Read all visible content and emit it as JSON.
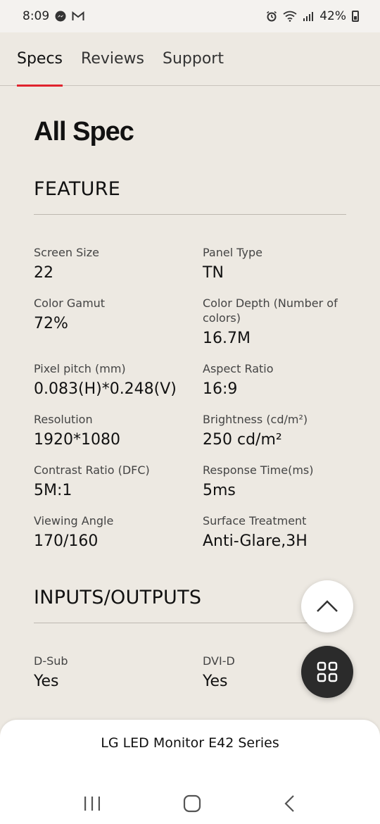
{
  "status_bar": {
    "time": "8:09",
    "battery_pct": "42%"
  },
  "tabs": [
    {
      "label": "Specs",
      "active": true
    },
    {
      "label": "Reviews",
      "active": false
    },
    {
      "label": "Support",
      "active": false
    }
  ],
  "page_title": "All Spec",
  "sections": [
    {
      "title": "FEATURE",
      "specs": [
        {
          "label": "Screen Size",
          "value": "22"
        },
        {
          "label": "Panel Type",
          "value": "TN"
        },
        {
          "label": "Color Gamut",
          "value": "72%"
        },
        {
          "label": "Color Depth (Number of colors)",
          "value": "16.7M"
        },
        {
          "label": "Pixel pitch (mm)",
          "value": "0.083(H)*0.248(V)"
        },
        {
          "label": "Aspect Ratio",
          "value": "16:9"
        },
        {
          "label": "Resolution",
          "value": "1920*1080"
        },
        {
          "label": "Brightness (cd/m²)",
          "value": "250 cd/m²"
        },
        {
          "label": "Contrast Ratio (DFC)",
          "value": "5M:1"
        },
        {
          "label": "Response Time(ms)",
          "value": "5ms"
        },
        {
          "label": "Viewing Angle",
          "value": "170/160"
        },
        {
          "label": "Surface Treatment",
          "value": "Anti-Glare,3H"
        }
      ]
    },
    {
      "title": "INPUTS/OUTPUTS",
      "specs": [
        {
          "label": "D-Sub",
          "value": "Yes"
        },
        {
          "label": "DVI-D",
          "value": "Yes"
        }
      ]
    }
  ],
  "product_name": "LG LED Monitor E42 Series",
  "colors": {
    "accent": "#e0232e",
    "background": "#ede9e2",
    "menu_fab": "#2b2b2b"
  }
}
